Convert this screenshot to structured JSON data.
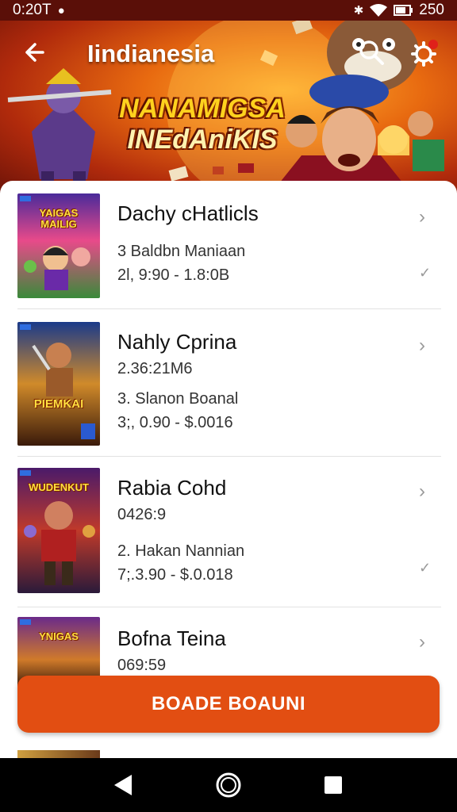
{
  "status_bar": {
    "time": "0:20T",
    "battery": "250",
    "icons": [
      "location-icon",
      "bluetooth-icon",
      "wifi-icon",
      "battery-icon"
    ]
  },
  "header": {
    "title": "Iindianesia",
    "banner_line1": "NANAMIGSA",
    "banner_line2": "INEdAniKIS",
    "icons": [
      "back-arrow-icon",
      "search-icon",
      "settings-icon"
    ]
  },
  "list": {
    "items": [
      {
        "thumb_title": "YAIGAS MAILIG",
        "title": "Dachy cHatlicls",
        "lines": [
          "3 Baldbn Maniaan",
          "2l, 9:90 - 1.8:0B"
        ],
        "checked": true
      },
      {
        "thumb_title": "PIEMKAI",
        "title": "Nahly Cprina",
        "lines": [
          "2.36:21M6",
          "3. Slanon Boanal",
          "3;, 0.90 - $.0016"
        ],
        "checked": false
      },
      {
        "thumb_title": "WUDENKUT",
        "title": "Rabia Cohd",
        "lines": [
          "0426:9",
          "2. Hakan Nannian",
          "7;.3.90 - $.0.018"
        ],
        "checked": true
      },
      {
        "thumb_title": "YNIGAS",
        "title": "Bofna Teina",
        "lines": [
          "069:59"
        ],
        "checked": false
      }
    ]
  },
  "cta": {
    "label": "BOADE BOAUNI"
  },
  "nav": {
    "icons": [
      "back-triangle-icon",
      "home-circle-icon",
      "recents-square-icon"
    ]
  },
  "colors": {
    "accent": "#e24e12",
    "header_dark": "#6a1208",
    "status_bar": "#5a0f08"
  }
}
